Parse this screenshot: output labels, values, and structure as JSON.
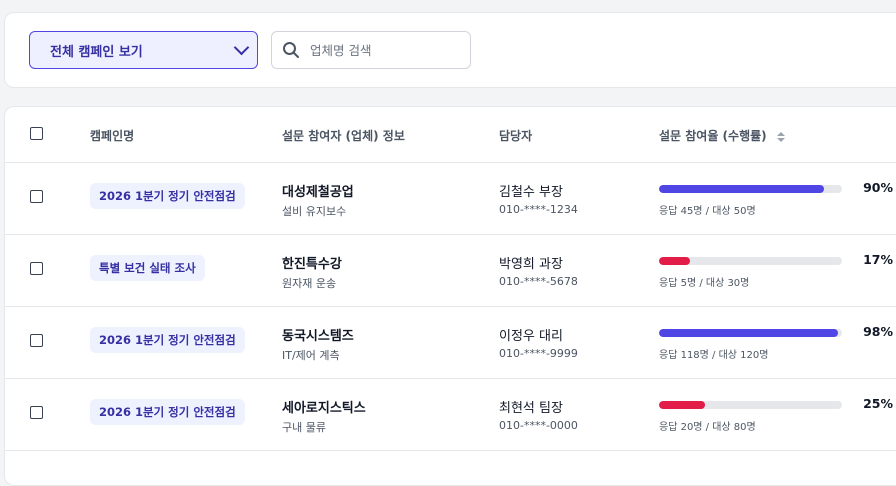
{
  "filter": {
    "campaign_select": "전체 캠페인 보기",
    "search_placeholder": "업체명 검색"
  },
  "table": {
    "headers": {
      "campaign": "캠페인명",
      "participant": "설문 참여자 (업체) 정보",
      "manager": "담당자",
      "participation": "설문 참여율 (수행률)"
    },
    "rows": [
      {
        "campaign": "2026 1분기 정기 안전점검",
        "company": "대성제철공업",
        "type": "설비 유지보수",
        "manager": "김철수 부장",
        "phone": "010-****-1234",
        "response": "응답 45명 / 대상 50명",
        "percent_label": "90%",
        "percent": 90,
        "color": "#4f46e5"
      },
      {
        "campaign": "특별 보건 실태 조사",
        "company": "한진특수강",
        "type": "원자재 운송",
        "manager": "박영희 과장",
        "phone": "010-****-5678",
        "response": "응답 5명 / 대상 30명",
        "percent_label": "17%",
        "percent": 17,
        "color": "#e11d48"
      },
      {
        "campaign": "2026 1분기 정기 안전점검",
        "company": "동국시스템즈",
        "type": "IT/제어 계측",
        "manager": "이정우 대리",
        "phone": "010-****-9999",
        "response": "응답 118명 / 대상 120명",
        "percent_label": "98%",
        "percent": 98,
        "color": "#4f46e5"
      },
      {
        "campaign": "2026 1분기 정기 안전점검",
        "company": "세아로지스틱스",
        "type": "구내 물류",
        "manager": "최현석 팀장",
        "phone": "010-****-0000",
        "response": "응답 20명 / 대상 80명",
        "percent_label": "25%",
        "percent": 25,
        "color": "#e11d48"
      }
    ]
  }
}
